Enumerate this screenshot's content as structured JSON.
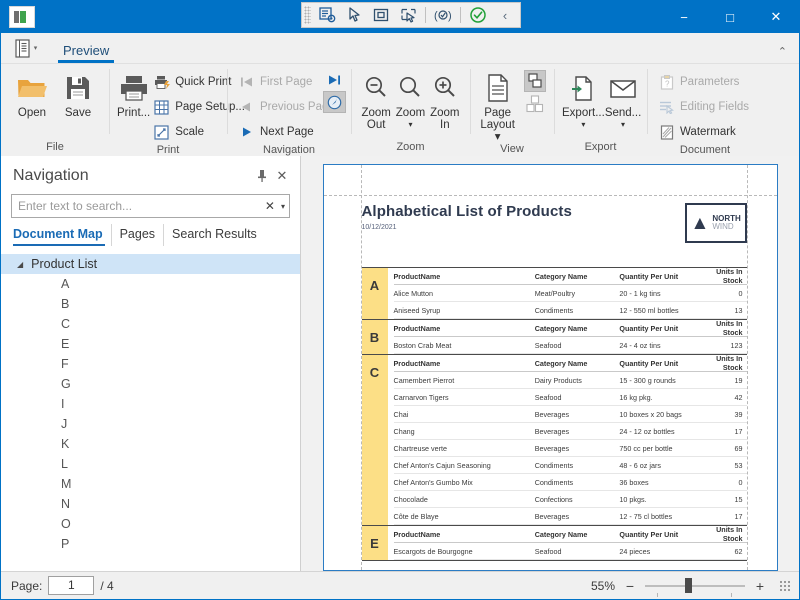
{
  "window": {
    "app_icon": "report-icon",
    "minimize": "−",
    "maximize": "□",
    "close": "✕"
  },
  "float_toolbar": {
    "items": [
      {
        "name": "inspect-element-icon",
        "label": "Inspect element"
      },
      {
        "name": "cursor-arrow-icon",
        "label": "Select"
      },
      {
        "name": "select-region-icon",
        "label": "Select region"
      },
      {
        "name": "pick-element-icon",
        "label": "Pick element"
      },
      {
        "name": "record-icon",
        "label": "Record"
      },
      {
        "name": "confirm-check-icon",
        "label": "Confirm"
      },
      {
        "name": "collapse-left-icon",
        "label": "‹"
      }
    ]
  },
  "ribbon": {
    "app_menu": "file-menu-button",
    "tabs": [
      {
        "label": "Preview",
        "active": true
      }
    ],
    "collapse": "⌃",
    "groups": [
      {
        "title": "File",
        "big_buttons": [
          {
            "label": "Open",
            "icon": "open-folder-icon"
          },
          {
            "label": "Save",
            "icon": "save-disk-icon"
          }
        ]
      },
      {
        "title": "Print",
        "big_buttons": [
          {
            "label": "Print...",
            "icon": "printer-icon"
          }
        ],
        "small_buttons": [
          {
            "label": "Quick Print",
            "icon": "quick-print-icon",
            "disabled": false
          },
          {
            "label": "Page Setup...",
            "icon": "page-setup-icon",
            "disabled": false
          },
          {
            "label": "Scale",
            "icon": "scale-icon",
            "disabled": false
          }
        ]
      },
      {
        "title": "Navigation",
        "small_buttons": [
          {
            "label": "First Page",
            "icon": "first-page-icon",
            "disabled": true
          },
          {
            "label": "Previous Page",
            "icon": "previous-page-icon",
            "disabled": true
          },
          {
            "label": "Next Page",
            "icon": "next-page-icon",
            "disabled": false
          }
        ],
        "extra_buttons": [
          {
            "label": "Last Page",
            "icon": "last-page-icon",
            "disabled": false
          },
          {
            "label": "Page Thumbnails",
            "icon": "compass-icon",
            "disabled": false
          }
        ]
      },
      {
        "title": "Zoom",
        "big_buttons": [
          {
            "label": "Zoom\nOut",
            "line1": "Zoom",
            "line2": "Out",
            "icon": "zoom-out-icon"
          },
          {
            "label": "Zoom",
            "line1": "Zoom",
            "line2": "▾",
            "icon": "zoom-icon"
          },
          {
            "label": "Zoom\nIn",
            "line1": "Zoom",
            "line2": "In",
            "icon": "zoom-in-icon"
          }
        ]
      },
      {
        "title": "View",
        "big_buttons": [
          {
            "label": "Page\nLayout",
            "line1": "Page",
            "line2": "Layout ▾",
            "icon": "page-layout-icon"
          }
        ],
        "toggles": [
          {
            "name": "continuous-view-toggle",
            "active": true
          },
          {
            "name": "facing-view-toggle",
            "active": false
          }
        ]
      },
      {
        "title": "Export",
        "big_buttons": [
          {
            "label": "Export...",
            "line1": "Export...",
            "line2": "▾",
            "icon": "export-icon"
          },
          {
            "label": "Send...",
            "line1": "Send...",
            "line2": "▾",
            "icon": "send-mail-icon"
          }
        ]
      },
      {
        "title": "Document",
        "small_buttons": [
          {
            "label": "Parameters",
            "icon": "parameters-icon",
            "disabled": true
          },
          {
            "label": "Editing Fields",
            "icon": "editing-fields-icon",
            "disabled": true
          },
          {
            "label": "Watermark",
            "icon": "watermark-icon",
            "disabled": false
          }
        ]
      }
    ]
  },
  "navigation": {
    "title": "Navigation",
    "pin": "pin-icon",
    "close": "✕",
    "search": {
      "placeholder": "Enter text to search...",
      "value": "",
      "clear": "✕",
      "dropdown": "▾"
    },
    "tabs": [
      {
        "label": "Document Map",
        "active": true
      },
      {
        "label": "Pages",
        "active": false
      },
      {
        "label": "Search Results",
        "active": false
      }
    ],
    "map": {
      "root": "Product List",
      "expander": "◢",
      "items": [
        "A",
        "B",
        "C",
        "E",
        "F",
        "G",
        "I",
        "J",
        "K",
        "L",
        "M",
        "N",
        "O",
        "P"
      ]
    }
  },
  "document": {
    "title": "Alphabetical List of Products",
    "date": "10/12/2021",
    "logo": {
      "chevron": "▲",
      "line1": "NORTH",
      "line2": "WIND"
    },
    "columns": [
      "ProductName",
      "Category Name",
      "Quantity Per Unit",
      "Units In Stock"
    ],
    "sections": [
      {
        "letter": "A",
        "rows": [
          [
            "Alice Mutton",
            "Meat/Poultry",
            "20 - 1 kg tins",
            "0"
          ],
          [
            "Aniseed Syrup",
            "Condiments",
            "12 - 550 ml bottles",
            "13"
          ]
        ]
      },
      {
        "letter": "B",
        "rows": [
          [
            "Boston Crab Meat",
            "Seafood",
            "24 - 4 oz tins",
            "123"
          ]
        ]
      },
      {
        "letter": "C",
        "rows": [
          [
            "Camembert Pierrot",
            "Dairy Products",
            "15 - 300 g rounds",
            "19"
          ],
          [
            "Carnarvon Tigers",
            "Seafood",
            "16 kg pkg.",
            "42"
          ],
          [
            "Chai",
            "Beverages",
            "10 boxes x 20 bags",
            "39"
          ],
          [
            "Chang",
            "Beverages",
            "24 - 12 oz bottles",
            "17"
          ],
          [
            "Chartreuse verte",
            "Beverages",
            "750 cc per bottle",
            "69"
          ],
          [
            "Chef Anton's Cajun Seasoning",
            "Condiments",
            "48 - 6 oz jars",
            "53"
          ],
          [
            "Chef Anton's Gumbo Mix",
            "Condiments",
            "36 boxes",
            "0"
          ],
          [
            "Chocolade",
            "Confections",
            "10 pkgs.",
            "15"
          ],
          [
            "Côte de Blaye",
            "Beverages",
            "12 - 75 cl bottles",
            "17"
          ]
        ]
      },
      {
        "letter": "E",
        "rows": [
          [
            "Escargots de Bourgogne",
            "Seafood",
            "24 pieces",
            "62"
          ]
        ]
      }
    ]
  },
  "status": {
    "page_label": "Page:",
    "page_value": "1",
    "page_total": "/ 4",
    "zoom_level": "55%",
    "zoom_out": "−",
    "zoom_in": "+"
  },
  "colors": {
    "accent": "#0072c6",
    "highlight": "#fcdf86",
    "tab_active": "#1a6bb5",
    "page_border": "#2b7cc4"
  }
}
